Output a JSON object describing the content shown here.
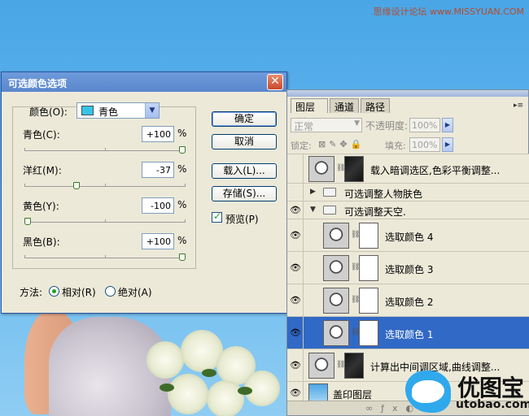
{
  "watermark_top": "思缘设计论坛 www.MISSYUAN.COM",
  "dialog": {
    "title": "可选颜色选项",
    "color_label": "颜色(O):",
    "color_value": "青色",
    "swatch_color": "#35c4e8",
    "sliders": [
      {
        "label": "青色(C):",
        "value": "+100",
        "unit": "%",
        "level": 100
      },
      {
        "label": "洋红(M):",
        "value": "-37",
        "unit": "%",
        "level": 31.5
      },
      {
        "label": "黄色(Y):",
        "value": "-100",
        "unit": "%",
        "level": 0
      },
      {
        "label": "黑色(B):",
        "value": "+100",
        "unit": "%",
        "level": 100
      }
    ],
    "method_label": "方法:",
    "method_options": [
      {
        "label": "相对(R)",
        "selected": true
      },
      {
        "label": "绝对(A)",
        "selected": false
      }
    ],
    "buttons": {
      "ok": "确定",
      "cancel": "取消",
      "load": "载入(L)...",
      "save": "存储(S)..."
    },
    "preview_label": "预览(P)",
    "preview_checked": true
  },
  "layers_panel": {
    "tabs": [
      "图层",
      "通道",
      "路径"
    ],
    "tab_close": "×",
    "blend_mode": "正常",
    "opacity_label": "不透明度:",
    "opacity_value": "100%",
    "lock_label": "锁定:",
    "fill_label": "填充:",
    "fill_value": "100%",
    "layers": [
      {
        "name": "载入暗调选区,色彩平衡调整...",
        "visible": false,
        "kind": "adjustment"
      },
      {
        "name": "可选调整人物肤色",
        "visible": false,
        "kind": "group",
        "expanded": false
      },
      {
        "name": "可选调整天空.",
        "visible": true,
        "kind": "group",
        "expanded": true
      },
      {
        "name": "选取颜色 4",
        "visible": true,
        "kind": "adjustment"
      },
      {
        "name": "选取颜色 3",
        "visible": true,
        "kind": "adjustment"
      },
      {
        "name": "选取颜色 2",
        "visible": true,
        "kind": "adjustment"
      },
      {
        "name": "选取颜色 1",
        "visible": true,
        "kind": "adjustment",
        "selected": true
      },
      {
        "name": "计算出中间调区域,曲线调整...",
        "visible": true,
        "kind": "adjustment"
      },
      {
        "name": "盖印图层",
        "visible": true,
        "kind": "image"
      }
    ]
  },
  "logo": {
    "name_cn": "优图宝",
    "name_en": "utobao.com"
  }
}
